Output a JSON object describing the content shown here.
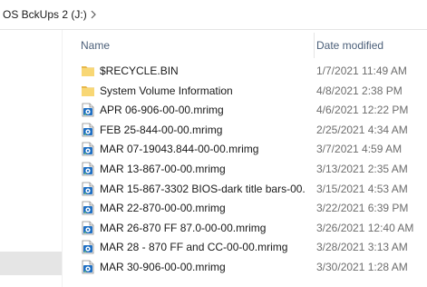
{
  "breadcrumb": {
    "drive": "OS BckUps 2 (J:)"
  },
  "columns": {
    "name": "Name",
    "date_modified": "Date modified"
  },
  "files": [
    {
      "name": "$RECYCLE.BIN",
      "date": "1/7/2021 11:49 AM",
      "type": "folder"
    },
    {
      "name": "System Volume Information",
      "date": "4/8/2021 2:38 PM",
      "type": "folder"
    },
    {
      "name": "APR 06-906-00-00.mrimg",
      "date": "4/6/2021 12:22 PM",
      "type": "mrimg"
    },
    {
      "name": "FEB 25-844-00-00.mrimg",
      "date": "2/25/2021 4:34 AM",
      "type": "mrimg"
    },
    {
      "name": "MAR 07-19043.844-00-00.mrimg",
      "date": "3/7/2021 4:59 AM",
      "type": "mrimg"
    },
    {
      "name": "MAR 13-867-00-00.mrimg",
      "date": "3/13/2021 2:35 AM",
      "type": "mrimg"
    },
    {
      "name": "MAR 15-867-3302 BIOS-dark title bars-00...",
      "date": "3/15/2021 4:53 AM",
      "type": "mrimg"
    },
    {
      "name": "MAR 22-870-00-00.mrimg",
      "date": "3/22/2021 6:39 PM",
      "type": "mrimg"
    },
    {
      "name": "MAR 26-870 FF 87.0-00-00.mrimg",
      "date": "3/26/2021 12:40 AM",
      "type": "mrimg"
    },
    {
      "name": "MAR 28 - 870 FF and CC-00-00.mrimg",
      "date": "3/28/2021 3:13 AM",
      "type": "mrimg"
    },
    {
      "name": "MAR 30-906-00-00.mrimg",
      "date": "3/30/2021 1:28 AM",
      "type": "mrimg"
    }
  ],
  "colors": {
    "header_text": "#4c607a",
    "date_text": "#6d6d6d",
    "folder_fill": "#f8d775",
    "mrimg_blue": "#1e6fc4",
    "selected_nav": "#e5e5e5"
  }
}
